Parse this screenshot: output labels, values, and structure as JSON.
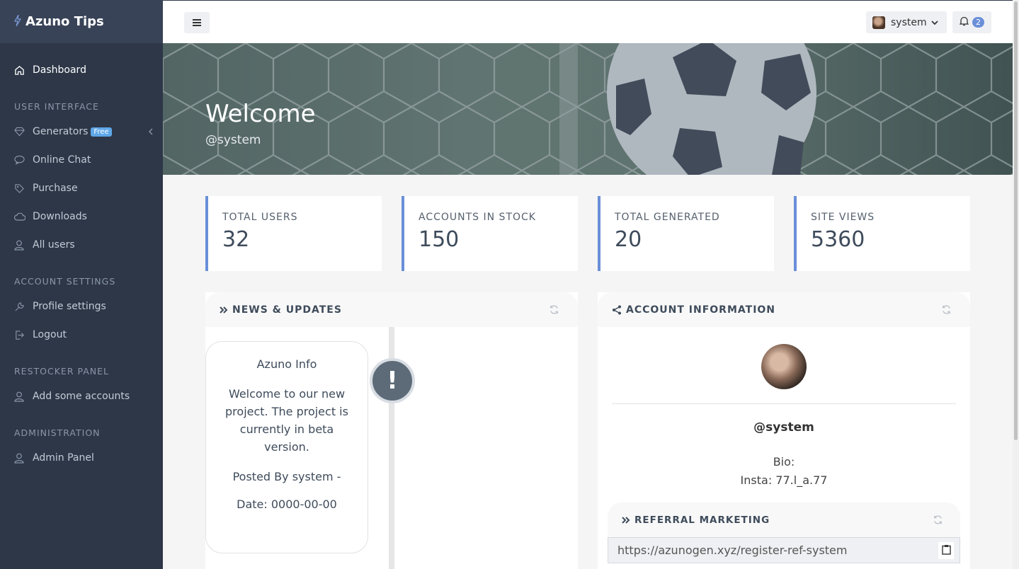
{
  "brand": {
    "name": "Azuno Tips"
  },
  "sidebar": {
    "items": [
      {
        "label": "Dashboard",
        "icon": "home-icon"
      },
      {
        "label": "Generators",
        "icon": "diamond-icon",
        "badge": "Free"
      },
      {
        "label": "Online Chat",
        "icon": "chat-icon"
      },
      {
        "label": "Purchase",
        "icon": "tag-icon"
      },
      {
        "label": "Downloads",
        "icon": "cloud-icon"
      },
      {
        "label": "All users",
        "icon": "user-icon"
      },
      {
        "label": "Profile settings",
        "icon": "wrench-icon"
      },
      {
        "label": "Logout",
        "icon": "logout-icon"
      },
      {
        "label": "Add some accounts",
        "icon": "user-icon"
      },
      {
        "label": "Admin Panel",
        "icon": "user-icon"
      }
    ],
    "headings": [
      "USER INTERFACE",
      "ACCOUNT SETTINGS",
      "RESTOCKER PANEL",
      "ADMINISTRATION"
    ]
  },
  "topbar": {
    "username": "system",
    "notification_count": "2"
  },
  "hero": {
    "title": "Welcome",
    "subtitle": "@system"
  },
  "stats": [
    {
      "label": "TOTAL USERS",
      "value": "32"
    },
    {
      "label": "ACCOUNTS IN STOCK",
      "value": "150"
    },
    {
      "label": "TOTAL GENERATED",
      "value": "20"
    },
    {
      "label": "SITE VIEWS",
      "value": "5360"
    }
  ],
  "news": {
    "title": "NEWS & UPDATES",
    "card": {
      "title": "Azuno Info",
      "text": "Welcome to our new project. The project is currently in beta version.",
      "posted": "Posted By system -",
      "date": "Date: 0000-00-00"
    },
    "marker": "!"
  },
  "account": {
    "title": "ACCOUNT INFORMATION",
    "name": "@system",
    "bio_label": "Bio:",
    "bio_text": "Insta: 77.l_a.77",
    "referral": {
      "title": "REFERRAL MARKETING",
      "link": "https://azunogen.xyz/register-ref-system"
    }
  },
  "colors": {
    "accent": "#6a8fd8",
    "sidebar_bg": "#2d3748",
    "badge_free": "#5fa8e8"
  }
}
